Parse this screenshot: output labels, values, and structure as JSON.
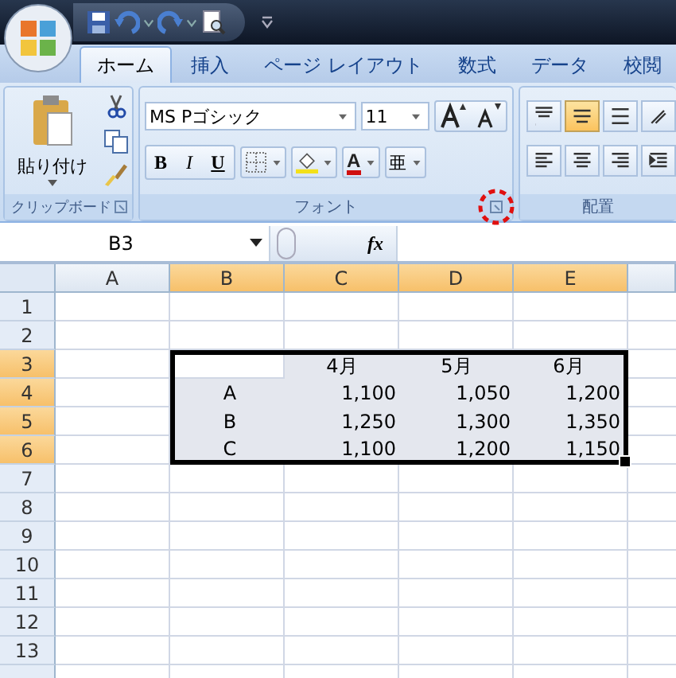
{
  "tabs": [
    {
      "label": "ホーム",
      "selected": true
    },
    {
      "label": "挿入",
      "selected": false
    },
    {
      "label": "ページ レイアウト",
      "selected": false
    },
    {
      "label": "数式",
      "selected": false
    },
    {
      "label": "データ",
      "selected": false
    },
    {
      "label": "校閲",
      "selected": false
    }
  ],
  "clipboard": {
    "paste_label": "貼り付け",
    "label": "クリップボード"
  },
  "font": {
    "font_name": "MS Pゴシック",
    "font_size": "11",
    "label": "フォント",
    "launcher_highlighted": true,
    "buttons": [
      {
        "kind": "bold",
        "label": "B"
      },
      {
        "kind": "italic",
        "label": "I"
      },
      {
        "kind": "underline",
        "label": "U"
      },
      {
        "kind": "border"
      },
      {
        "kind": "fill"
      },
      {
        "kind": "color",
        "label": "A"
      },
      {
        "kind": "phonetic",
        "label": "亜"
      }
    ]
  },
  "alignment": {
    "label": "配置",
    "buttons": [
      {
        "kind": "top",
        "selected": false
      },
      {
        "kind": "middle",
        "selected": true
      },
      {
        "kind": "bottom",
        "selected": false
      },
      {
        "kind": "orientation",
        "selected": false
      },
      {
        "kind": "left",
        "selected": false
      },
      {
        "kind": "center",
        "selected": false
      },
      {
        "kind": "right",
        "selected": false
      },
      {
        "kind": "indent",
        "selected": false
      }
    ]
  },
  "formula_bar": {
    "name_box": "B3",
    "function_label": "fx"
  },
  "sheet": {
    "columns": [
      {
        "header": "A",
        "selected": false
      },
      {
        "header": "B",
        "selected": true
      },
      {
        "header": "C",
        "selected": true
      },
      {
        "header": "D",
        "selected": true
      },
      {
        "header": "E",
        "selected": true
      }
    ],
    "rows": [
      {
        "header": "1",
        "selected": false,
        "cells": []
      },
      {
        "header": "2",
        "selected": false,
        "cells": []
      },
      {
        "header": "3",
        "selected": true,
        "cells": [
          {},
          {
            "shaded": false
          },
          {
            "text": "4月",
            "kind": "label",
            "shaded": true
          },
          {
            "text": "5月",
            "kind": "label",
            "shaded": true
          },
          {
            "text": "6月",
            "kind": "label",
            "shaded": true
          }
        ]
      },
      {
        "header": "4",
        "selected": true,
        "cells": [
          {},
          {
            "text": "A",
            "kind": "label",
            "shaded": true
          },
          {
            "text": "1,100",
            "kind": "number",
            "shaded": true
          },
          {
            "text": "1,050",
            "kind": "number",
            "shaded": true
          },
          {
            "text": "1,200",
            "kind": "number",
            "shaded": true
          }
        ]
      },
      {
        "header": "5",
        "selected": true,
        "cells": [
          {},
          {
            "text": "B",
            "kind": "label",
            "shaded": true
          },
          {
            "text": "1,250",
            "kind": "number",
            "shaded": true
          },
          {
            "text": "1,300",
            "kind": "number",
            "shaded": true
          },
          {
            "text": "1,350",
            "kind": "number",
            "shaded": true
          }
        ]
      },
      {
        "header": "6",
        "selected": true,
        "cells": [
          {},
          {
            "text": "C",
            "kind": "label",
            "shaded": true
          },
          {
            "text": "1,100",
            "kind": "number",
            "shaded": true
          },
          {
            "text": "1,200",
            "kind": "number",
            "shaded": true
          },
          {
            "text": "1,150",
            "kind": "number",
            "shaded": true
          }
        ]
      },
      {
        "header": "7",
        "selected": false,
        "cells": []
      },
      {
        "header": "8",
        "selected": false,
        "cells": []
      },
      {
        "header": "9",
        "selected": false,
        "cells": []
      },
      {
        "header": "10",
        "selected": false,
        "cells": []
      },
      {
        "header": "11",
        "selected": false,
        "cells": []
      },
      {
        "header": "12",
        "selected": false,
        "cells": []
      },
      {
        "header": "13",
        "selected": false,
        "cells": []
      }
    ]
  }
}
